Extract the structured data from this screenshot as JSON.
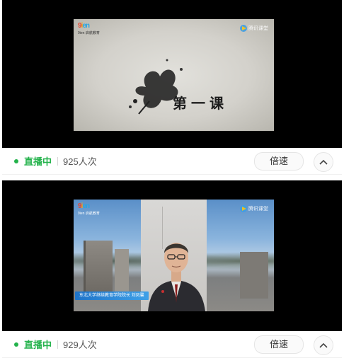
{
  "streams": [
    {
      "brand_logo": "9ien 启航教育",
      "partner_logo": "腾讯课堂",
      "video_title": "第一课",
      "live_label": "直播中",
      "viewers": "925人次",
      "speed_label": "倍速",
      "expand_icon": "chevron-up-icon"
    },
    {
      "brand_logo": "9ien 启航教育",
      "partner_logo": "腾讯课堂",
      "caption": "东北大学继续教育学院院长 刘凤馨",
      "live_label": "直播中",
      "viewers": "929人次",
      "speed_label": "倍速",
      "expand_icon": "chevron-up-icon"
    }
  ],
  "colors": {
    "live_green": "#23b24b",
    "player_bg": "#000000",
    "caption_blue": "#1e73c8"
  }
}
